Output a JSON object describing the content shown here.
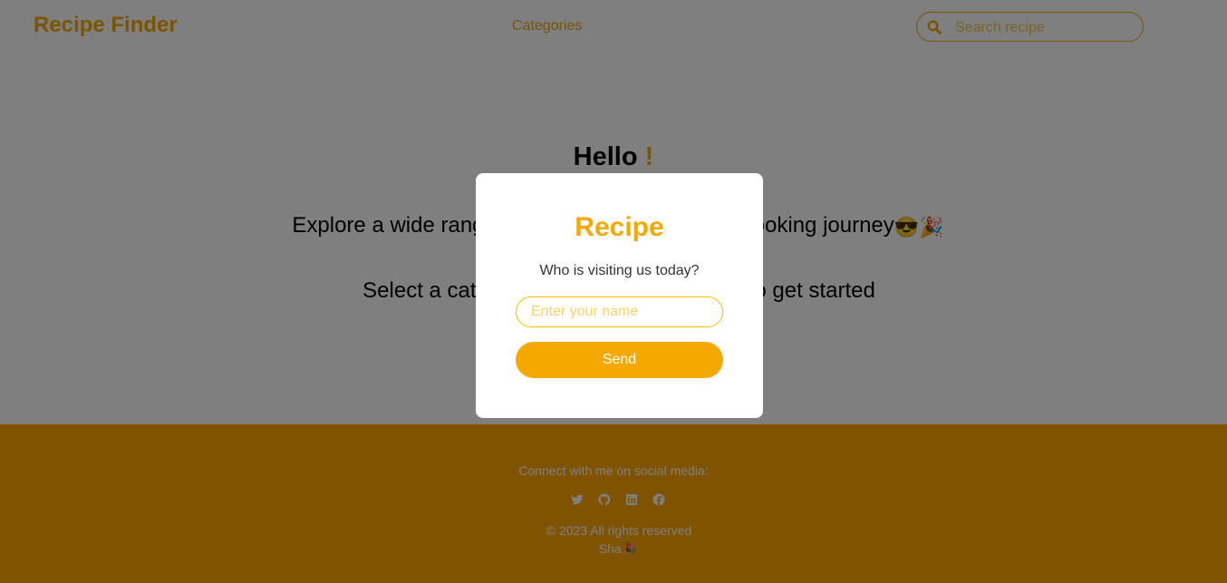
{
  "header": {
    "brand": "Recipe Finder",
    "nav": {
      "categories": "Categories"
    },
    "search": {
      "placeholder": "Search recipe",
      "value": ""
    }
  },
  "hero": {
    "greeting": "Hello",
    "greeting_mark": "!",
    "tagline": "Explore a wide range of recipes and start your cooking journey",
    "tagline_emojis": "😎🎉",
    "subline": "Select a category or search for a recipe to get started"
  },
  "footer": {
    "connect_text": "Connect with me on social media:",
    "social_icons": [
      "twitter-icon",
      "github-icon",
      "linkedin-icon",
      "facebook-icon"
    ],
    "copyright": "© 2023 All rights reserved",
    "signature": "Sha",
    "signature_emoji": "🎉"
  },
  "modal": {
    "title": "Recipe",
    "question": "Who is visiting us today?",
    "name_placeholder": "Enter your name",
    "name_value": "",
    "send_label": "Send"
  },
  "colors": {
    "accent": "#f5a800",
    "footer_bg": "#ffa600",
    "overlay": "rgba(0,0,0,0.5)"
  }
}
